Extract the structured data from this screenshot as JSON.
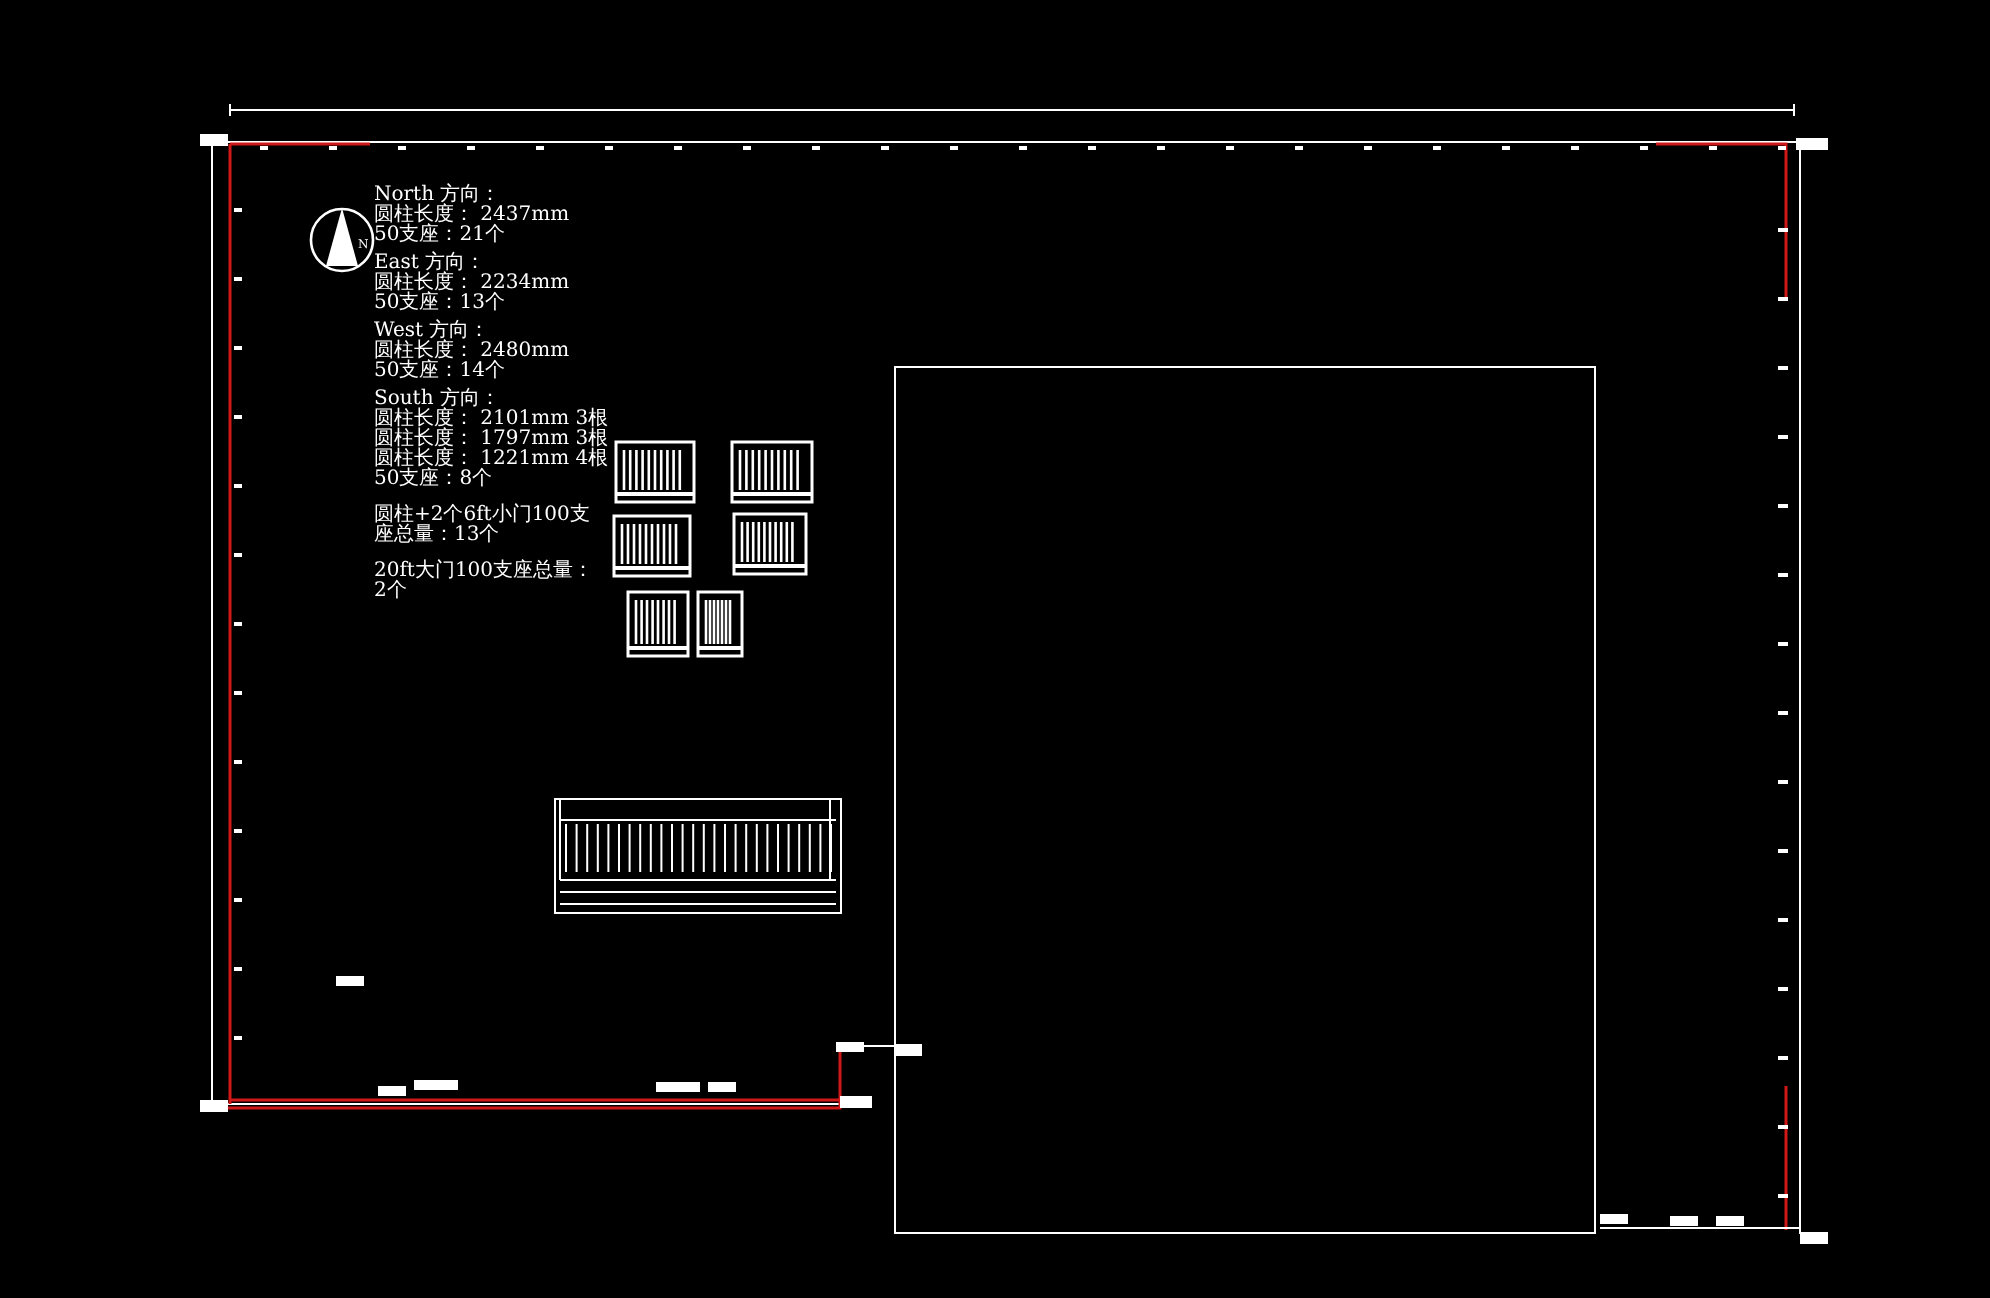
{
  "compass": {
    "label": "N"
  },
  "notes": [
    {
      "heading": "North 方向：",
      "lines": [
        "圆柱长度： 2437mm",
        "50支座：21个"
      ]
    },
    {
      "heading": "East 方向：",
      "lines": [
        "圆柱长度： 2234mm",
        "50支座：13个"
      ]
    },
    {
      "heading": "West 方向：",
      "lines": [
        "圆柱长度： 2480mm",
        "50支座：14个"
      ]
    },
    {
      "heading": "South 方向：",
      "lines": [
        "圆柱长度： 2101mm 3根",
        "圆柱长度： 1797mm 3根",
        "圆柱长度： 1221mm 4根",
        "50支座：8个"
      ]
    }
  ],
  "summary": [
    "圆柱+2个6ft小门100支座总量：13个",
    "20ft大门100支座总量：2个"
  ]
}
